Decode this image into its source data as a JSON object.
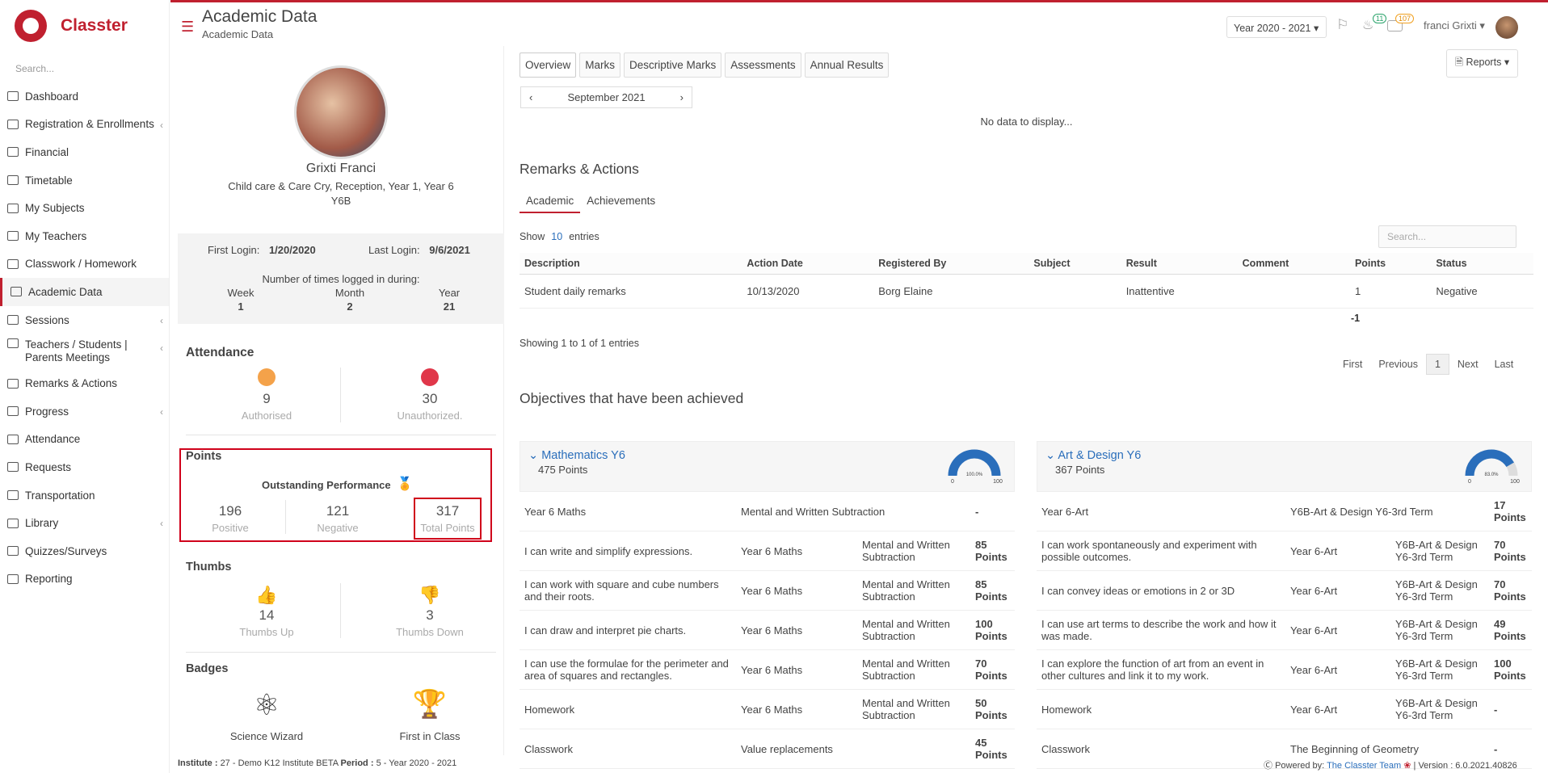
{
  "app": {
    "name": "Classter",
    "search_placeholder": "Search..."
  },
  "sidebar": {
    "items": [
      {
        "label": "Dashboard",
        "icon": "laptop-icon",
        "chev": false
      },
      {
        "label": "Registration & Enrollments",
        "icon": "bank-icon",
        "chev": true
      },
      {
        "label": "Financial",
        "icon": "coins-icon",
        "chev": false
      },
      {
        "label": "Timetable",
        "icon": "calendar-icon",
        "chev": false
      },
      {
        "label": "My Subjects",
        "icon": "book-icon",
        "chev": false
      },
      {
        "label": "My Teachers",
        "icon": "users-icon",
        "chev": false
      },
      {
        "label": "Classwork / Homework",
        "icon": "list-icon",
        "chev": false
      },
      {
        "label": "Academic Data",
        "icon": "id-card-icon",
        "chev": false,
        "active": true
      },
      {
        "label": "Sessions",
        "icon": "users-icon",
        "chev": true
      },
      {
        "label": "Teachers / Students | Parents Meetings",
        "icon": "meeting-icon",
        "chev": true
      },
      {
        "label": "Remarks & Actions",
        "icon": "shuffle-icon",
        "chev": false
      },
      {
        "label": "Progress",
        "icon": "graduation-cap-icon",
        "chev": true
      },
      {
        "label": "Attendance",
        "icon": "user-check-icon",
        "chev": false
      },
      {
        "label": "Requests",
        "icon": "document-icon",
        "chev": false
      },
      {
        "label": "Transportation",
        "icon": "bus-icon",
        "chev": false
      },
      {
        "label": "Library",
        "icon": "books-icon",
        "chev": true
      },
      {
        "label": "Quizzes/Surveys",
        "icon": "checklist-icon",
        "chev": false
      },
      {
        "label": "Reporting",
        "icon": "printer-icon",
        "chev": false
      }
    ]
  },
  "header": {
    "title": "Academic Data",
    "subtitle": "Academic Data",
    "year": "Year 2020 - 2021",
    "notif_count": "11",
    "mail_count": "107",
    "user": "franci Grixti"
  },
  "profile": {
    "name": "Grixti Franci",
    "classes": "Child care & Care Cry, Reception, Year 1, Year 6",
    "class": "Y6B",
    "first_login_label": "First Login:",
    "first_login": "1/20/2020",
    "last_login_label": "Last Login:",
    "last_login": "9/6/2021",
    "times_label": "Number of times logged in during:",
    "week_label": "Week",
    "week": "1",
    "month_label": "Month",
    "month": "2",
    "year_label": "Year",
    "year": "21"
  },
  "attendance": {
    "title": "Attendance",
    "authorised": "9",
    "authorised_label": "Authorised",
    "unauthorized": "30",
    "unauthorized_label": "Unauthorized."
  },
  "points": {
    "title": "Points",
    "outstanding": "Outstanding Performance",
    "positive": "196",
    "positive_label": "Positive",
    "negative": "121",
    "negative_label": "Negative",
    "total": "317",
    "total_label": "Total Points"
  },
  "thumbs": {
    "title": "Thumbs",
    "up": "14",
    "up_label": "Thumbs Up",
    "down": "3",
    "down_label": "Thumbs Down"
  },
  "badges": {
    "title": "Badges",
    "items": [
      {
        "label": "Science Wizard",
        "icon": "atom-icon"
      },
      {
        "label": "First in Class",
        "icon": "medal-icon"
      }
    ]
  },
  "tabs": [
    "Overview",
    "Marks",
    "Descriptive Marks",
    "Assessments",
    "Annual Results"
  ],
  "reports_label": "Reports",
  "month": "September 2021",
  "no_data": "No data to display...",
  "remarks": {
    "title": "Remarks & Actions",
    "tabs": [
      "Academic",
      "Achievements"
    ],
    "show": "Show",
    "entries_n": "10",
    "entries": "entries",
    "search_placeholder": "Search...",
    "columns": [
      "Description",
      "Action Date",
      "Registered By",
      "Subject",
      "Result",
      "Comment",
      "Points",
      "Status"
    ],
    "rows": [
      [
        "Student daily remarks",
        "10/13/2020",
        "Borg Elaine",
        "",
        "Inattentive",
        "",
        "1",
        "Negative"
      ]
    ],
    "total": "-1",
    "showing": "Showing 1 to 1 of 1 entries",
    "pager": [
      "First",
      "Previous",
      "1",
      "Next",
      "Last"
    ]
  },
  "objectives": {
    "title": "Objectives that have been achieved",
    "groups": [
      {
        "name": "Mathematics Y6",
        "points": "475 Points",
        "gauge_pct": "100.0%",
        "gauge_value": 1.0,
        "gauge_min": "0",
        "gauge_max": "100",
        "rows": [
          [
            "Year 6 Maths",
            "Mental and Written Subtraction",
            "",
            "-"
          ],
          [
            "I can write and simplify expressions.",
            "Year 6 Maths",
            "Mental and Written Subtraction",
            "85 Points"
          ],
          [
            "I can work with square and cube numbers and their roots.",
            "Year 6 Maths",
            "Mental and Written Subtraction",
            "85 Points"
          ],
          [
            "I can draw and interpret pie charts.",
            "Year 6 Maths",
            "Mental and Written Subtraction",
            "100 Points"
          ],
          [
            "I can use the formulae for the perimeter and area of squares and rectangles.",
            "Year 6 Maths",
            "Mental and Written Subtraction",
            "70 Points"
          ],
          [
            "Homework",
            "Year 6 Maths",
            "Mental and Written Subtraction",
            "50 Points"
          ],
          [
            "Classwork",
            "Value replacements",
            "",
            "45 Points"
          ]
        ]
      },
      {
        "name": "Art & Design Y6",
        "points": "367 Points",
        "gauge_pct": "83.0%",
        "gauge_value": 0.83,
        "gauge_min": "0",
        "gauge_max": "100",
        "rows": [
          [
            "Year 6-Art",
            "Y6B-Art & Design Y6-3rd Term",
            "",
            "17 Points"
          ],
          [
            "I can work spontaneously and experiment with possible outcomes.",
            "Year 6-Art",
            "Y6B-Art & Design Y6-3rd Term",
            "70 Points"
          ],
          [
            "I can convey ideas or emotions in 2 or 3D",
            "Year 6-Art",
            "Y6B-Art & Design Y6-3rd Term",
            "70 Points"
          ],
          [
            "I can use art terms to describe the work and how it was made.",
            "Year 6-Art",
            "Y6B-Art & Design Y6-3rd Term",
            "49 Points"
          ],
          [
            "I can explore the function of art from an event in other cultures and link it to my work.",
            "Year 6-Art",
            "Y6B-Art & Design Y6-3rd Term",
            "100 Points"
          ],
          [
            "Homework",
            "Year 6-Art",
            "Y6B-Art & Design Y6-3rd Term",
            "-"
          ],
          [
            "Classwork",
            "The Beginning of Geometry",
            "",
            "-"
          ]
        ]
      }
    ]
  },
  "footer": {
    "institute_label": "Institute :",
    "institute": "27 - Demo K12 Institute BETA",
    "period_label": "Period :",
    "period": "5 - Year 2020 - 2021",
    "powered": "Powered by:",
    "team": "The Classter Team",
    "version": "| Version : 6.0.2021.40826"
  },
  "colors": {
    "accent": "#c0202f",
    "link": "#2a6ebb",
    "highlight": "#d0021b"
  }
}
